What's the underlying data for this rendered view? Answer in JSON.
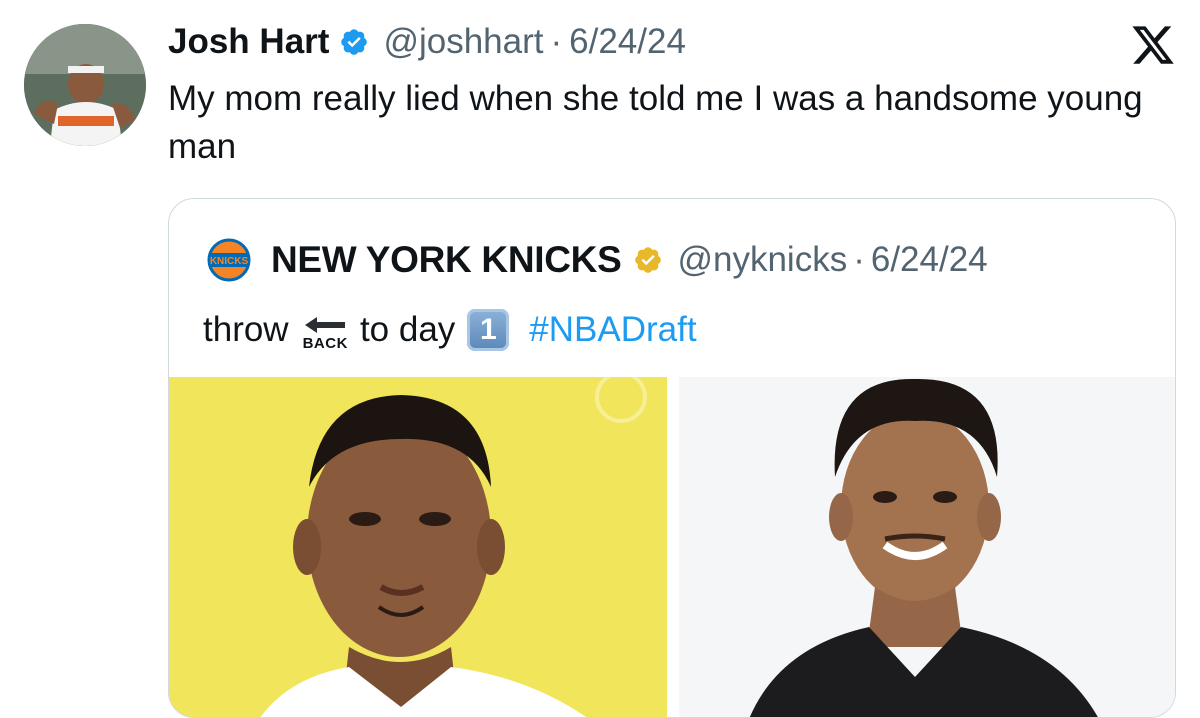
{
  "tweet": {
    "author": {
      "display_name": "Josh Hart",
      "handle": "@joshhart",
      "verified_icon": "verified-badge-blue",
      "avatar": "avatar-photo"
    },
    "separator": "·",
    "date": "6/24/24",
    "text": "My mom really lied when she told me I was a handsome young man",
    "brand_icon": "x-logo-icon"
  },
  "quote": {
    "author": {
      "display_name": "NEW YORK KNICKS",
      "handle": "@nyknicks",
      "verified_icon": "verified-badge-gold",
      "logo": "knicks-logo-icon"
    },
    "separator": "·",
    "date": "6/24/24",
    "text": {
      "before": "throw",
      "back_emoji_label": "BACK",
      "middle": "to day",
      "keycap": "1",
      "hashtag": "#NBADraft"
    },
    "media": [
      {
        "name": "photo-left",
        "background": "#f1e55b"
      },
      {
        "name": "photo-right",
        "background": "#f4f6f8"
      }
    ]
  },
  "colors": {
    "text": "#0f1419",
    "muted": "#536471",
    "link": "#1d9bf0",
    "border": "#cfd9de",
    "verified_blue": "#1d9bf0",
    "verified_gold": "#e8b82a"
  }
}
